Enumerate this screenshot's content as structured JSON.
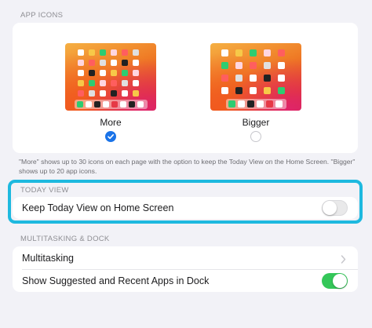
{
  "app_icons": {
    "header": "APP ICONS",
    "options": [
      {
        "label": "More",
        "selected": true
      },
      {
        "label": "Bigger",
        "selected": false
      }
    ],
    "footnote": "\"More\" shows up to 30 icons on each page with the option to keep the Today View on the Home Screen. \"Bigger\" shows up to 20 app icons."
  },
  "today_view": {
    "header": "TODAY VIEW",
    "keep_label": "Keep Today View on Home Screen",
    "keep_on": false
  },
  "multitasking_dock": {
    "header": "MULTITASKING & DOCK",
    "multitasking_label": "Multitasking",
    "suggested_label": "Show Suggested and Recent Apps in Dock",
    "suggested_on": true
  },
  "colors": {
    "accent": "#1a73e8",
    "toggle_on": "#34c759",
    "highlight": "#1eb9df"
  }
}
